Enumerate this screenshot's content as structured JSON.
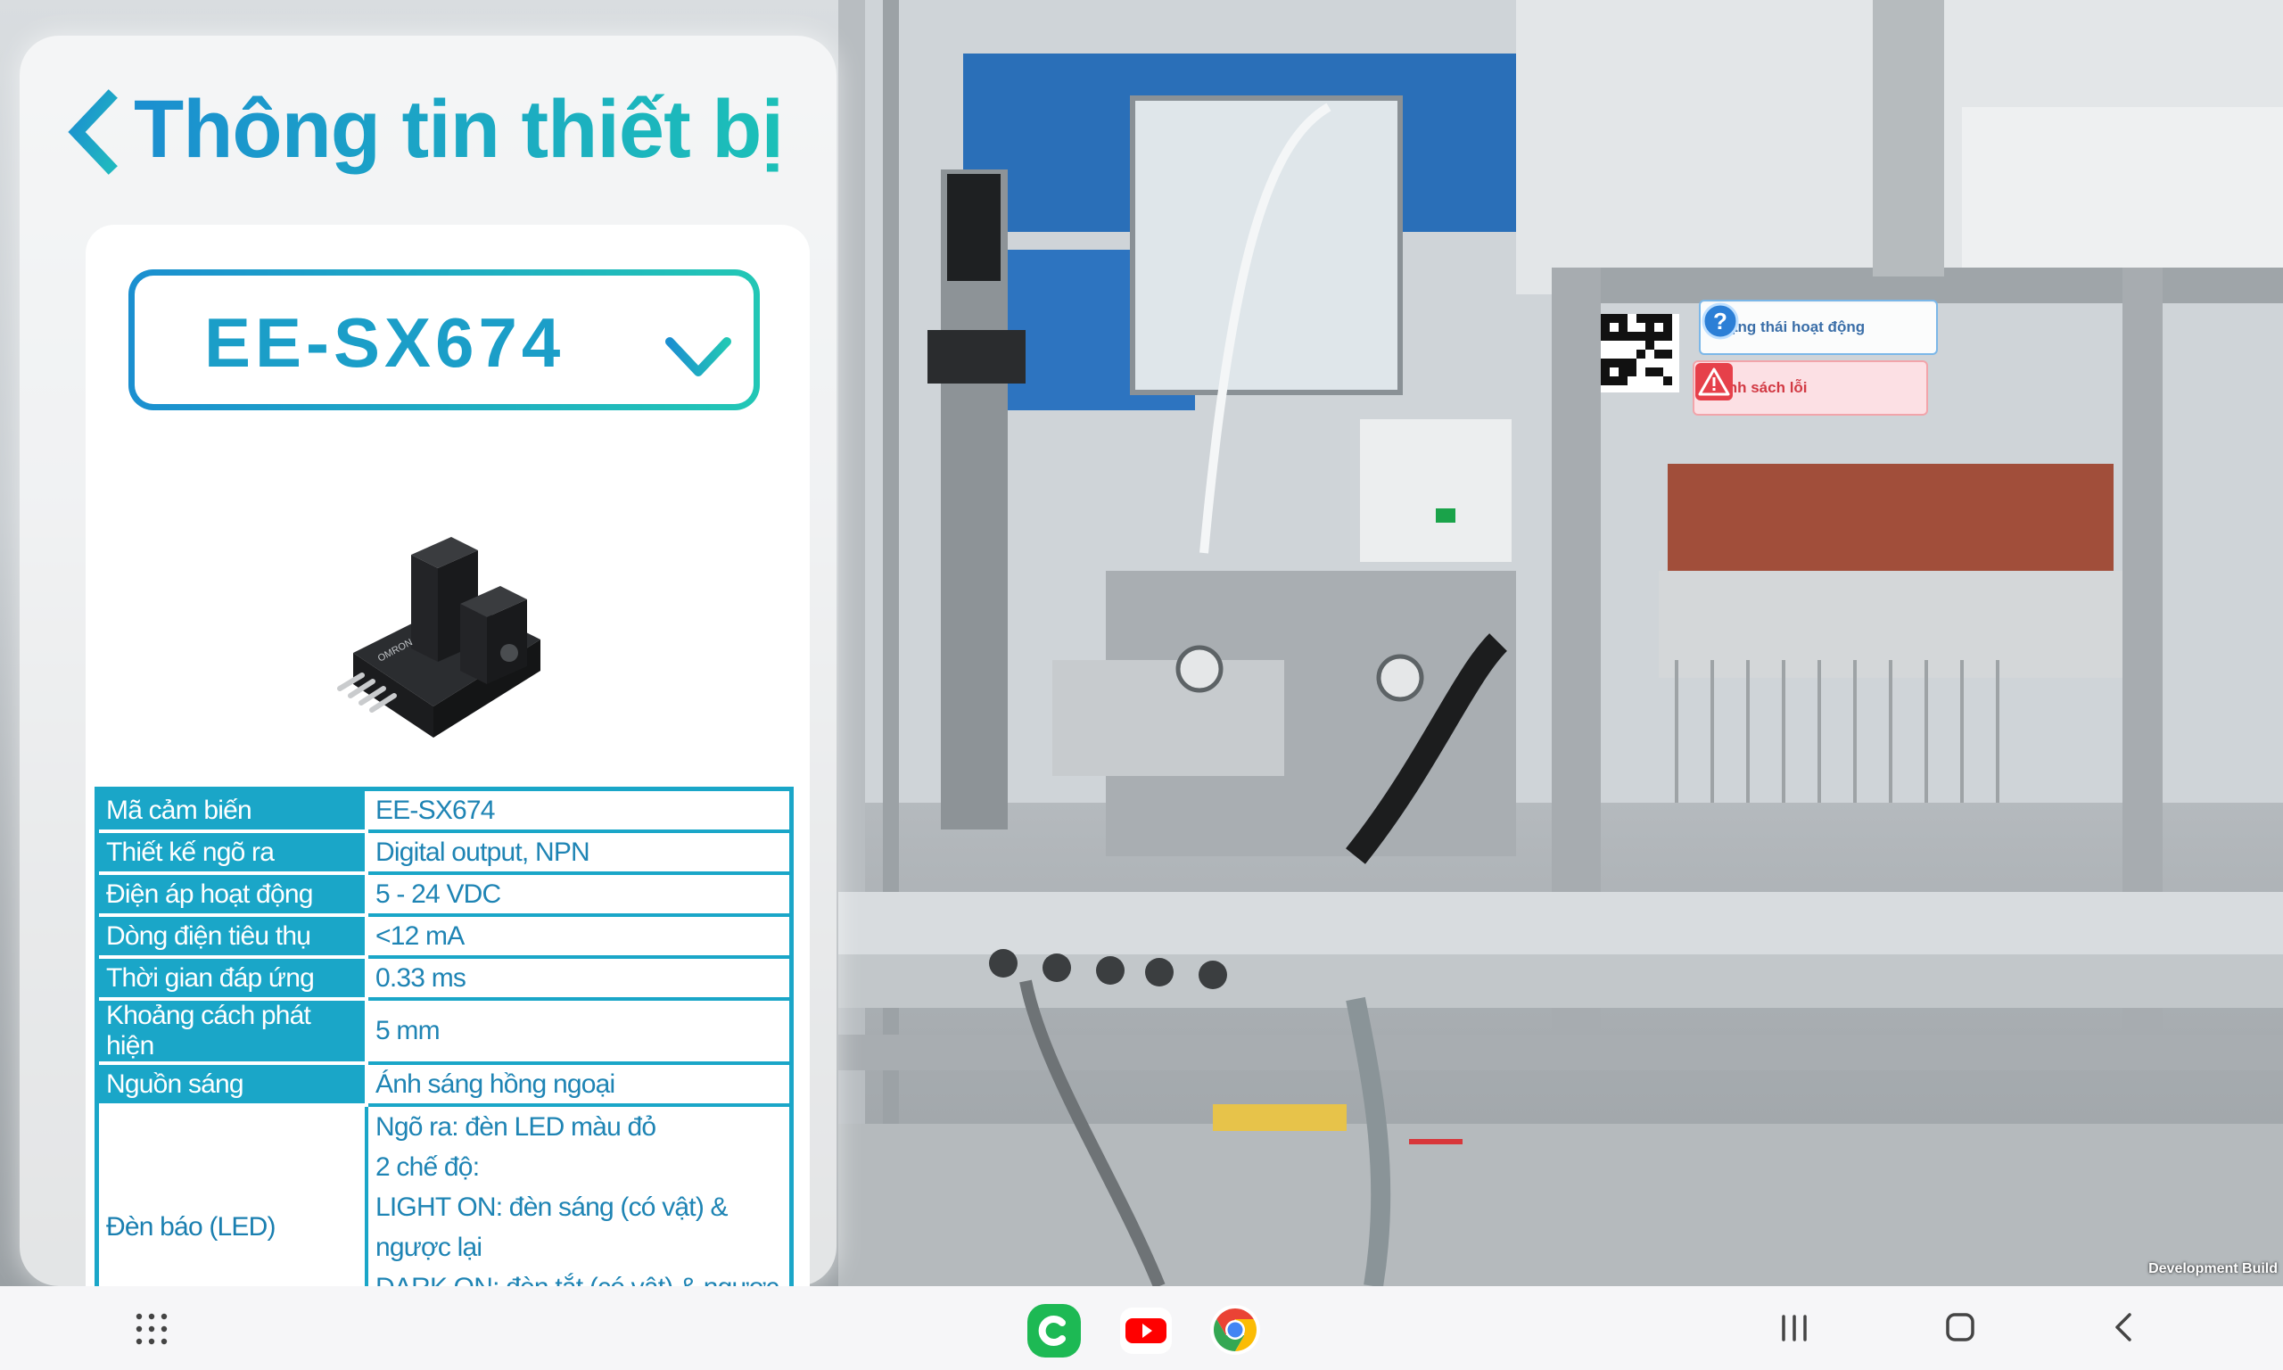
{
  "header": {
    "title": "Thông tin thiết bị"
  },
  "selector": {
    "value": "EE-SX674"
  },
  "specs": [
    {
      "label": "Mã cảm biến",
      "value": "EE-SX674"
    },
    {
      "label": "Thiết kế ngõ ra",
      "value": "Digital output, NPN"
    },
    {
      "label": "Điện áp hoạt động",
      "value": "5 - 24 VDC"
    },
    {
      "label": "Dòng điện tiêu thụ",
      "value": "<12 mA"
    },
    {
      "label": "Thời gian đáp ứng",
      "value": "0.33 ms"
    },
    {
      "label": "Khoảng cách phát hiện",
      "value": "5 mm"
    },
    {
      "label": "Nguồn sáng",
      "value": "Ánh sáng hồng ngoại"
    }
  ],
  "led": {
    "label": "Đèn báo (LED)",
    "lines": [
      "Ngõ ra: đèn LED màu đỏ",
      "2 chế độ:",
      "LIGHT ON: đèn sáng (có vật) & ngược lại",
      "DARK ON: đèn tắt (có vật) & ngược lại"
    ]
  },
  "ar": {
    "status_label": "Trạng thái hoạt động",
    "errors_label": "Danh sách lỗi"
  },
  "footer": {
    "dev_build": "Development Build"
  },
  "colors": {
    "accent": "#1aa6c8",
    "accent_dark": "#1b8fd0",
    "error": "#d23a44"
  },
  "navbar": {
    "apps": "grid-icon",
    "pinned_apps": [
      "kakaotalk-icon",
      "youtube-icon",
      "chrome-icon"
    ],
    "buttons": [
      "recents-icon",
      "home-icon",
      "back-icon"
    ]
  }
}
